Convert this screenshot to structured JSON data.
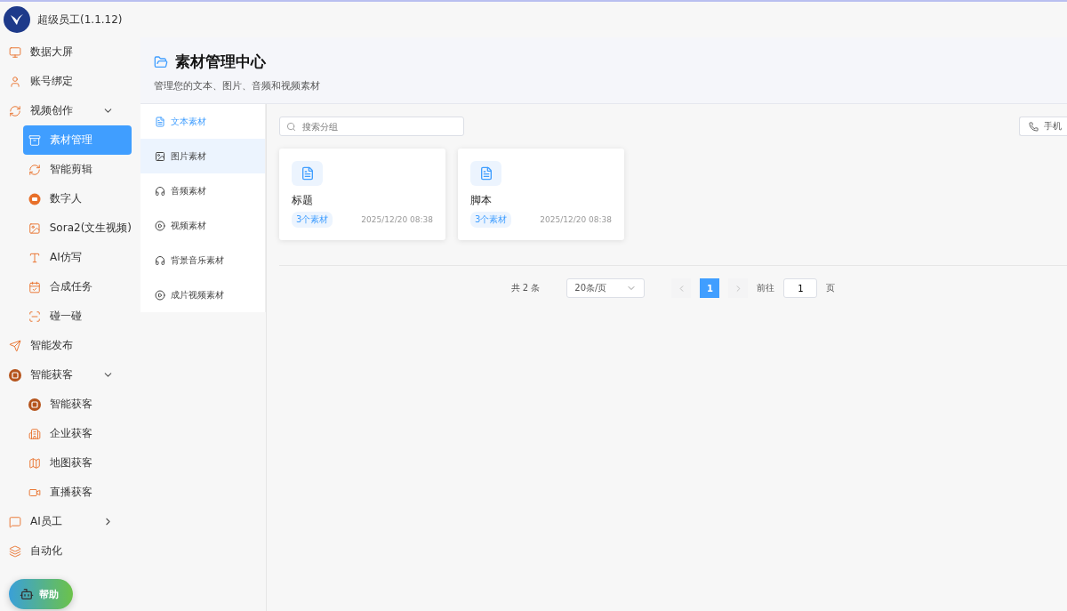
{
  "app": {
    "title": "超级员工(1.1.12)"
  },
  "sidebar": {
    "items": [
      {
        "label": "数据大屏"
      },
      {
        "label": "账号绑定"
      },
      {
        "label": "视频创作",
        "expanded": true,
        "children": [
          {
            "label": "素材管理",
            "selected": true
          },
          {
            "label": "智能剪辑",
            "selected": false
          },
          {
            "label": "数字人",
            "selected": false
          },
          {
            "label": "Sora2(文生视频)",
            "selected": false
          },
          {
            "label": "AI仿写",
            "selected": false
          },
          {
            "label": "合成任务",
            "selected": false
          },
          {
            "label": "碰一碰",
            "selected": false
          }
        ]
      },
      {
        "label": "智能发布"
      },
      {
        "label": "智能获客",
        "expanded": true,
        "children": [
          {
            "label": "智能获客",
            "selected": false
          },
          {
            "label": "企业获客",
            "selected": false
          },
          {
            "label": "地图获客",
            "selected": false
          },
          {
            "label": "直播获客",
            "selected": false
          }
        ]
      },
      {
        "label": "AI员工",
        "expanded": false
      },
      {
        "label": "自动化"
      }
    ]
  },
  "help_button": {
    "label": "帮助"
  },
  "header": {
    "title": "素材管理中心",
    "subtitle": "管理您的文本、图片、音频和视频素材"
  },
  "categories": [
    {
      "label": "文本素材",
      "selected": true,
      "hovered": false
    },
    {
      "label": "图片素材",
      "selected": false,
      "hovered": true
    },
    {
      "label": "音频素材",
      "selected": false,
      "hovered": false
    },
    {
      "label": "视频素材",
      "selected": false,
      "hovered": false
    },
    {
      "label": "背景音乐素材",
      "selected": false,
      "hovered": false
    },
    {
      "label": "成片视频素材",
      "selected": false,
      "hovered": false
    }
  ],
  "search": {
    "placeholder": "搜索分组"
  },
  "phone_button": {
    "label": "手机"
  },
  "groups": [
    {
      "name": "标题",
      "count": "3个素材",
      "date": "2025/12/20 08:38"
    },
    {
      "name": "脚本",
      "count": "3个素材",
      "date": "2025/12/20 08:38"
    }
  ],
  "pagination": {
    "total": "共 2 条",
    "page_size": "20条/页",
    "pages": [
      {
        "label": "1",
        "selected": true
      }
    ],
    "goto_label": "前往",
    "goto_value": "1",
    "page_suffix": "页"
  }
}
